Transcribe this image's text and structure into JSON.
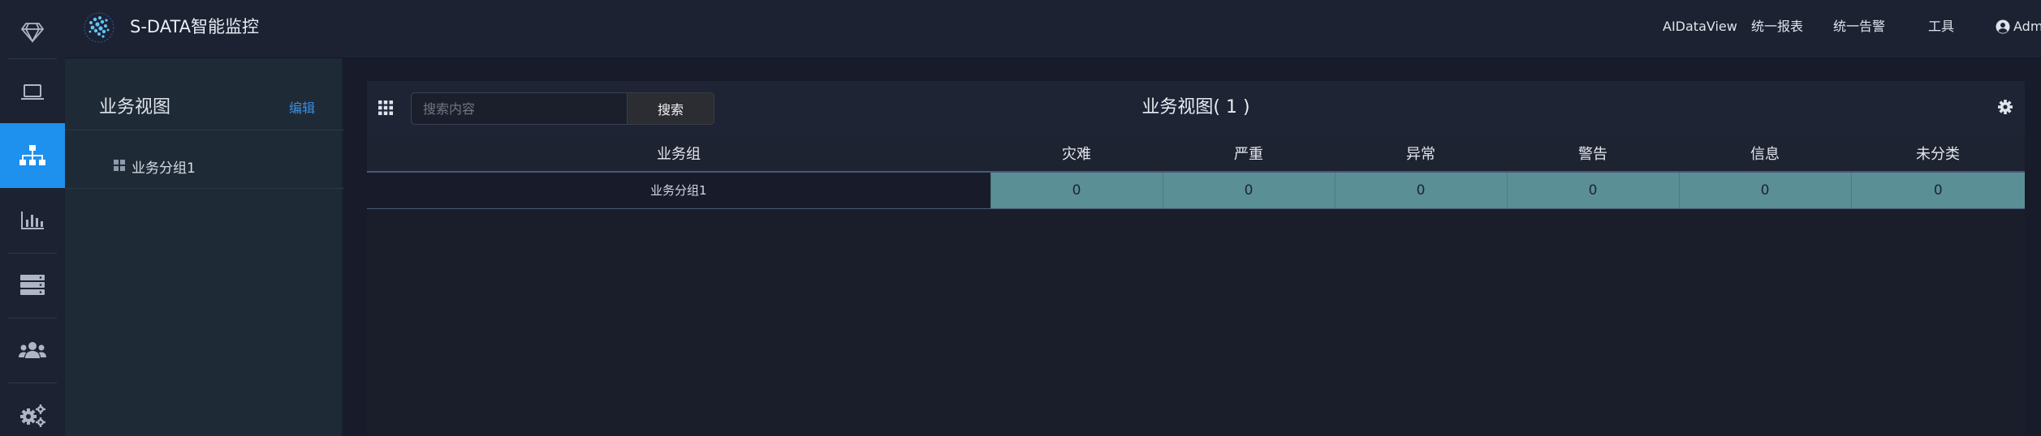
{
  "app": {
    "title": "S-DATA智能监控"
  },
  "topnav": {
    "items": [
      "AIDataView",
      "统一报表",
      "统一告警",
      "工具"
    ],
    "user_label": "Adm"
  },
  "rail": {
    "items": [
      {
        "icon": "diamond-icon"
      },
      {
        "icon": "laptop-icon"
      },
      {
        "icon": "sitemap-icon",
        "active": true
      },
      {
        "icon": "bar-chart-icon"
      },
      {
        "icon": "server-icon"
      },
      {
        "icon": "users-icon"
      },
      {
        "icon": "cogs-icon"
      }
    ]
  },
  "tree": {
    "title": "业务视图",
    "edit_label": "编辑",
    "nodes": [
      "业务分组1"
    ]
  },
  "main": {
    "search": {
      "placeholder": "搜索内容",
      "value": "",
      "button_label": "搜索"
    },
    "title": "业务视图( 1 )",
    "table": {
      "columns": [
        "业务组",
        "灾难",
        "严重",
        "异常",
        "警告",
        "信息",
        "未分类"
      ],
      "rows": [
        {
          "group": "业务分组1",
          "counts": [
            "0",
            "0",
            "0",
            "0",
            "0",
            "0"
          ]
        }
      ]
    }
  },
  "colors": {
    "accent": "#1e90ee",
    "count_cell": "#5a8f95",
    "edit_link": "#3a8fe0"
  }
}
